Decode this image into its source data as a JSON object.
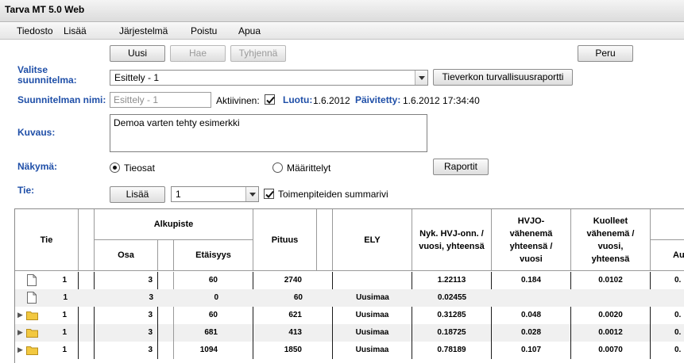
{
  "app": {
    "title": "Tarva MT 5.0 Web"
  },
  "menu": [
    "Tiedosto",
    "Lisää",
    "Järjestelmä",
    "Poistu",
    "Apua"
  ],
  "toolbar": {
    "new_label": "Uusi",
    "search_label": "Hae",
    "clear_label": "Tyhjennä",
    "cancel_label": "Peru"
  },
  "form": {
    "plan_select_label": "Valitse suunnitelma:",
    "plan_select_value": "Esittely - 1",
    "report_button": "Tieverkon turvallisuusraportti",
    "plan_name_label": "Suunnitelman nimi:",
    "plan_name_value": "Esittely - 1",
    "active_label": "Aktiivinen:",
    "active_checked": true,
    "created_label": "Luotu:",
    "created_value": "1.6.2012",
    "updated_label": "Päivitetty:",
    "updated_value": "1.6.2012 17:34:40",
    "description_label": "Kuvaus:",
    "description_value": "Demoa varten tehty esimerkki",
    "view_label": "Näkymä:",
    "view_options": [
      "Tieosat",
      "Määrittelyt"
    ],
    "view_selected": "Tieosat",
    "reports_button": "Raportit",
    "road_label": "Tie:",
    "add_button": "Lisää",
    "road_select_value": "1",
    "summary_row_label": "Toimenpiteiden summarivi",
    "summary_row_checked": true
  },
  "table": {
    "headers": {
      "road": "Tie",
      "start_point": "Alkupiste",
      "part": "Osa",
      "distance": "Etäisyys",
      "length": "Pituus",
      "ely": "ELY",
      "hvj": "Nyk. HVJ-onn. / vuosi, yhteensä",
      "hvjo": "HVJO-vähenemä yhteensä / vuosi",
      "deaths": "Kuolleet vähenemä / vuosi, yhteensä",
      "next": "Au"
    },
    "rows": [
      {
        "icon": "document-icon",
        "expandable": false,
        "road": "1",
        "part": "3",
        "distance": "60",
        "length": "2740",
        "ely": "",
        "hvj": "1.22113",
        "hvjo": "0.184",
        "deaths": "0.0102",
        "next": "0."
      },
      {
        "icon": "document-icon",
        "expandable": false,
        "road": "1",
        "part": "3",
        "distance": "0",
        "length": "60",
        "ely": "Uusimaa",
        "hvj": "0.02455",
        "hvjo": "",
        "deaths": "",
        "next": ""
      },
      {
        "icon": "folder-icon",
        "expandable": true,
        "road": "1",
        "part": "3",
        "distance": "60",
        "length": "621",
        "ely": "Uusimaa",
        "hvj": "0.31285",
        "hvjo": "0.048",
        "deaths": "0.0020",
        "next": "0."
      },
      {
        "icon": "folder-icon",
        "expandable": true,
        "road": "1",
        "part": "3",
        "distance": "681",
        "length": "413",
        "ely": "Uusimaa",
        "hvj": "0.18725",
        "hvjo": "0.028",
        "deaths": "0.0012",
        "next": "0."
      },
      {
        "icon": "folder-icon",
        "expandable": true,
        "road": "1",
        "part": "3",
        "distance": "1094",
        "length": "1850",
        "ely": "Uusimaa",
        "hvj": "0.78189",
        "hvjo": "0.107",
        "deaths": "0.0070",
        "next": "0."
      }
    ]
  },
  "colors": {
    "label_blue": "#1f4fa8",
    "folder_yellow": "#f2c840",
    "row_alt": "#f0f0f0"
  }
}
